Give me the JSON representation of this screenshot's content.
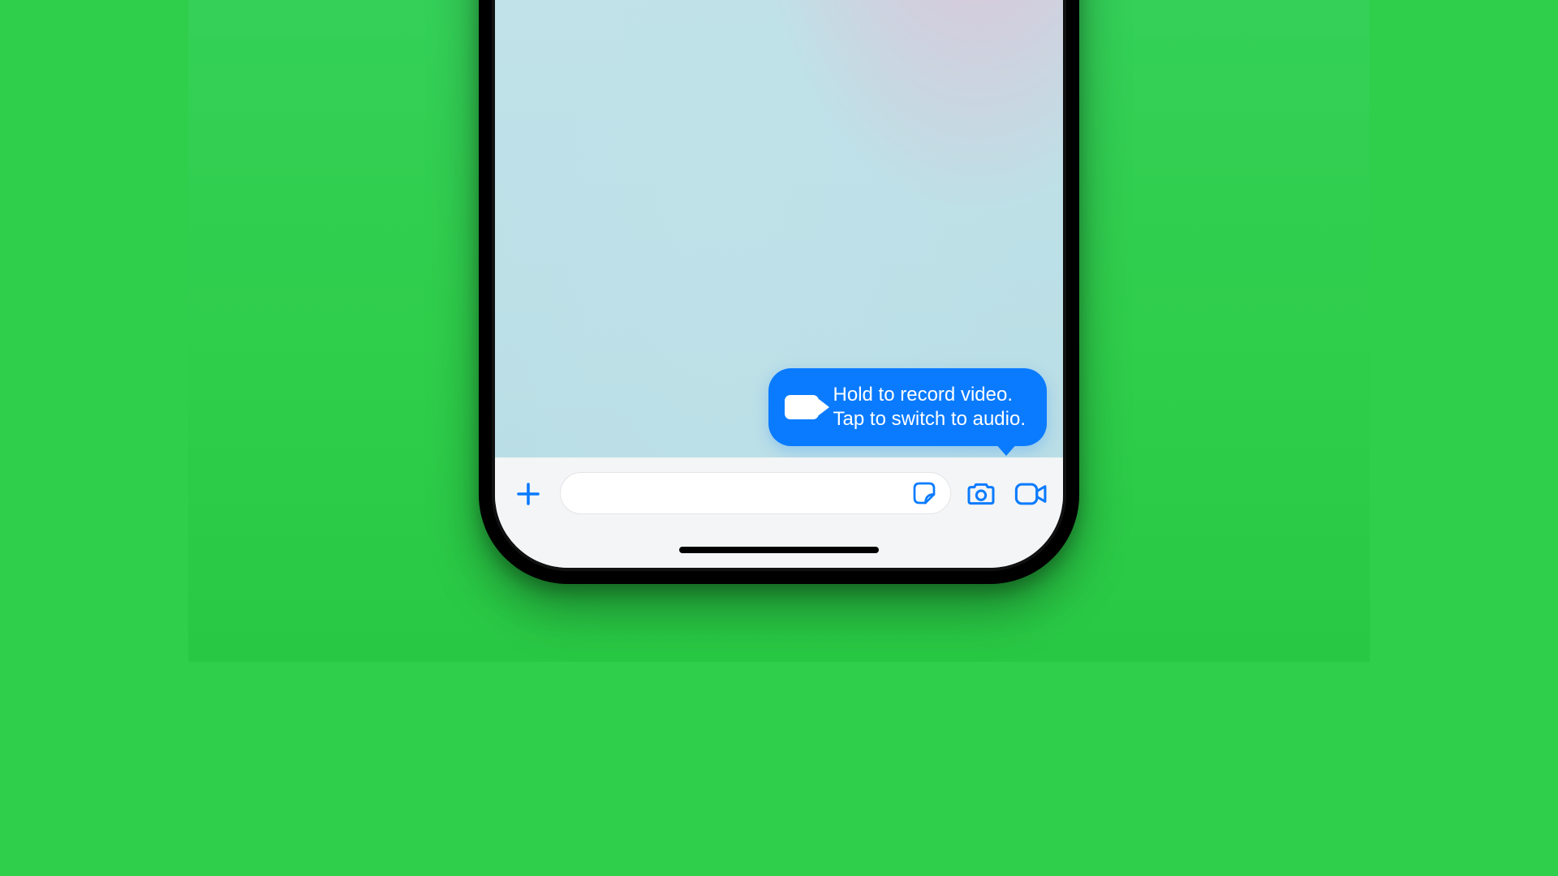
{
  "tooltip": {
    "line1": "Hold to record video.",
    "line2": "Tap to switch to audio."
  },
  "input": {
    "placeholder": ""
  },
  "colors": {
    "accent": "#0a7bff",
    "stage_bg": "#2fce4b"
  },
  "icons": {
    "plus": "plus-icon",
    "sticker": "sticker-icon",
    "camera": "camera-icon",
    "video": "video-icon",
    "tooltip_video": "video-icon"
  }
}
